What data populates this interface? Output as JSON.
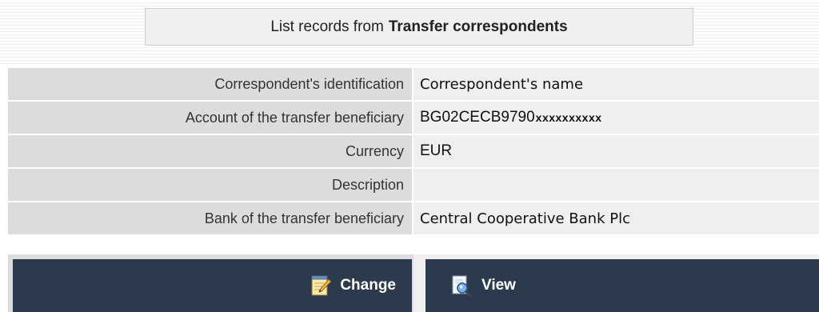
{
  "title": {
    "prefix": "List records from",
    "name": "Transfer correspondents"
  },
  "record": {
    "rows": [
      {
        "label": "Correspondent's identification",
        "value": "Correspondent's name"
      },
      {
        "label": "Account of the transfer beneficiary",
        "value": "BG02CECB9790",
        "value_mask": "xxxxxxxxxx"
      },
      {
        "label": "Currency",
        "value": "EUR"
      },
      {
        "label": "Description",
        "value": ""
      },
      {
        "label": "Bank of the transfer beneficiary",
        "value": "Central Cooperative Bank Plc"
      }
    ]
  },
  "actions": {
    "change_label": "Change",
    "change_icon": "edit-notepad-icon",
    "view_label": "View",
    "view_icon": "magnifier-document-icon"
  },
  "colors": {
    "button_bg": "#2b3a4c",
    "label_bg": "#dcdcdc",
    "value_bg": "#efefef"
  }
}
